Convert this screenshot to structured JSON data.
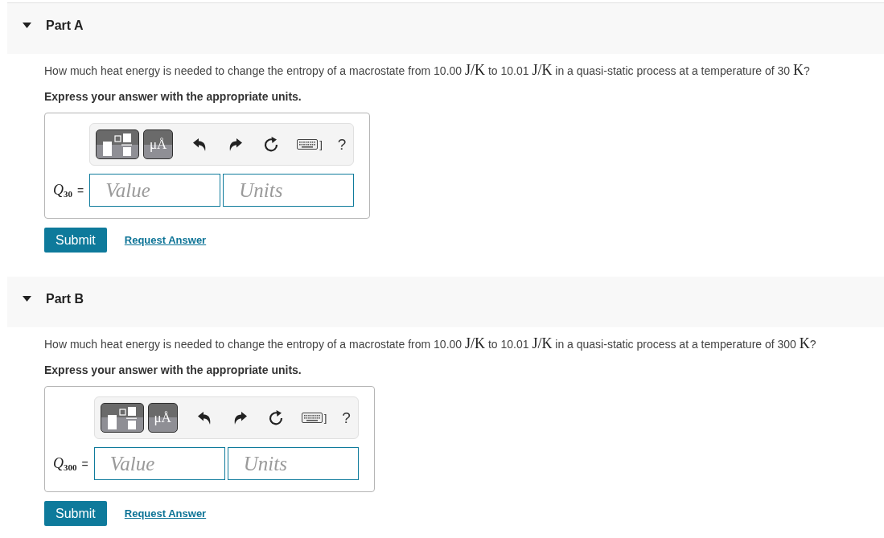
{
  "parts": [
    {
      "title": "Part A",
      "expanded": true,
      "question": [
        {
          "kind": "text",
          "text": "How much heat energy is needed to change the entropy of a macrostate from 10.00 "
        },
        {
          "kind": "math",
          "text": "J/K"
        },
        {
          "kind": "text",
          "text": " to 10.01 "
        },
        {
          "kind": "math",
          "text": "J/K"
        },
        {
          "kind": "text",
          "text": " in a quasi-static process at a temperature of 30 "
        },
        {
          "kind": "math",
          "text": "K"
        },
        {
          "kind": "text",
          "text": "?"
        }
      ],
      "instruction": "Express your answer with the appropriate units.",
      "answer": {
        "label": "*Q*$_{30}$",
        "relation": "=",
        "toolbar": [
          {
            "kind": "template"
          },
          {
            "kind": "units",
            "text": "μÅ"
          },
          {
            "kind": "undo"
          },
          {
            "kind": "redo"
          },
          {
            "kind": "reset"
          },
          {
            "kind": "keyboard",
            "text": "]"
          },
          {
            "kind": "help",
            "text": "?"
          }
        ],
        "fields": [
          {
            "placeholder": "Value"
          },
          {
            "placeholder": "Units"
          }
        ]
      },
      "submit": "Submit",
      "link": "Request Answer"
    },
    {
      "title": "Part B",
      "expanded": true,
      "question": [
        {
          "kind": "text",
          "text": "How much heat energy is needed to change the entropy of a macrostate from 10.00 "
        },
        {
          "kind": "math",
          "text": "J/K"
        },
        {
          "kind": "text",
          "text": " to 10.01 "
        },
        {
          "kind": "math",
          "text": "J/K"
        },
        {
          "kind": "text",
          "text": " in a quasi-static process at a temperature of 300 "
        },
        {
          "kind": "math",
          "text": "K"
        },
        {
          "kind": "text",
          "text": "?"
        }
      ],
      "instruction": "Express your answer with the appropriate units.",
      "answer": {
        "label": "*Q*$_{300}$",
        "relation": "=",
        "toolbar": [
          {
            "kind": "template"
          },
          {
            "kind": "units",
            "text": "μÅ"
          },
          {
            "kind": "undo"
          },
          {
            "kind": "redo"
          },
          {
            "kind": "reset"
          },
          {
            "kind": "keyboard",
            "text": "]"
          },
          {
            "kind": "help",
            "text": "?"
          }
        ],
        "fields": [
          {
            "placeholder": "Value"
          },
          {
            "placeholder": "Units"
          }
        ]
      },
      "submit": "Submit",
      "link": "Request Answer"
    }
  ]
}
